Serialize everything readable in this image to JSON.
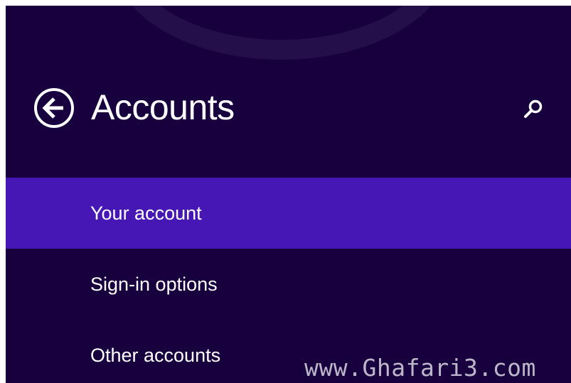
{
  "header": {
    "title": "Accounts",
    "back_icon": "back-arrow-circle-icon",
    "search_icon": "search-icon"
  },
  "nav": {
    "items": [
      {
        "label": "Your account",
        "selected": true
      },
      {
        "label": "Sign-in options",
        "selected": false
      },
      {
        "label": "Other accounts",
        "selected": false
      }
    ]
  },
  "watermark": {
    "text": "www.Ghafari3.com"
  },
  "colors": {
    "background": "#18003f",
    "selected": "#4617b4",
    "text": "#ffffff"
  }
}
